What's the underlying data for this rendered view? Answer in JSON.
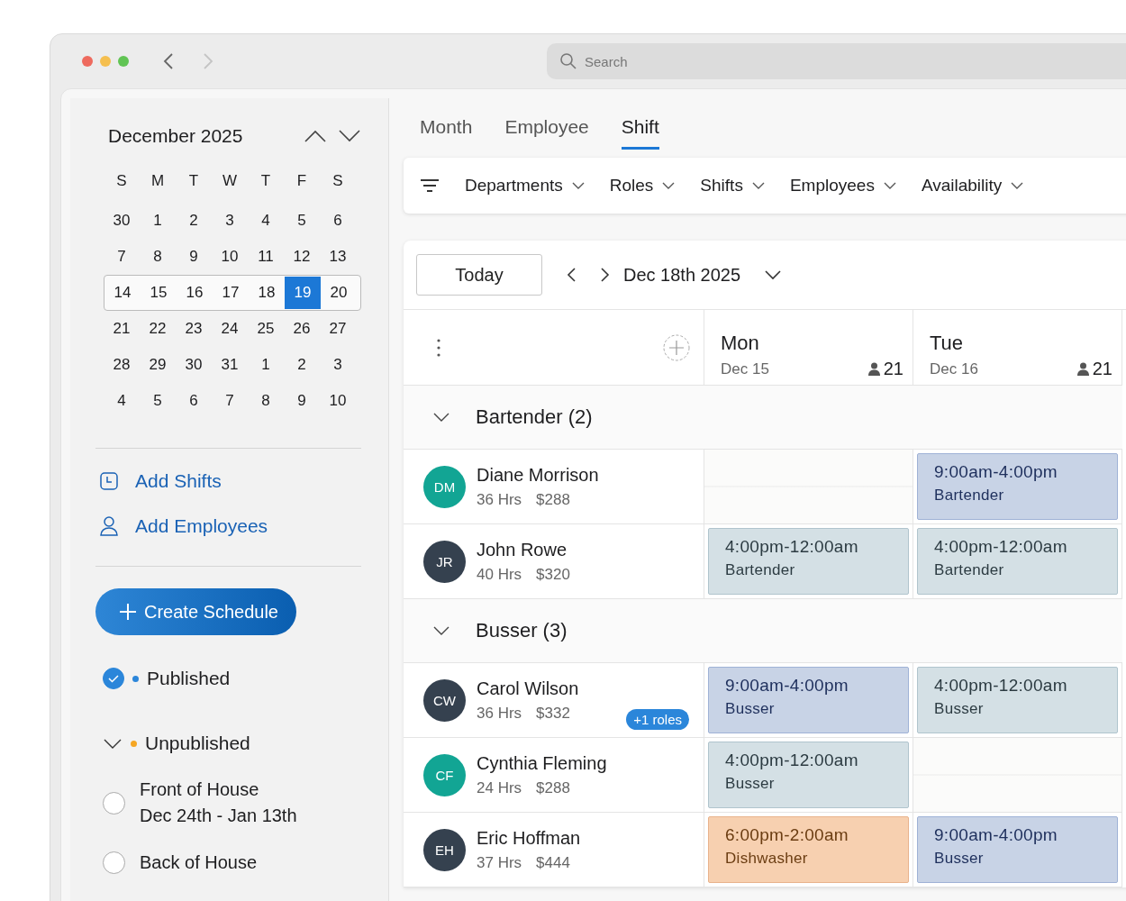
{
  "toolbar": {
    "search": {
      "placeholder": "Search"
    }
  },
  "calendar": {
    "title": "December 2025",
    "weekdays": [
      "S",
      "M",
      "T",
      "W",
      "T",
      "F",
      "S"
    ],
    "weeks": [
      {
        "selected": false,
        "days": [
          {
            "label": "30",
            "selected": false
          },
          {
            "label": "1",
            "selected": false
          },
          {
            "label": "2",
            "selected": false
          },
          {
            "label": "3",
            "selected": false
          },
          {
            "label": "4",
            "selected": false
          },
          {
            "label": "5",
            "selected": false
          },
          {
            "label": "6",
            "selected": false
          }
        ]
      },
      {
        "selected": false,
        "days": [
          {
            "label": "7",
            "selected": false
          },
          {
            "label": "8",
            "selected": false
          },
          {
            "label": "9",
            "selected": false
          },
          {
            "label": "10",
            "selected": false
          },
          {
            "label": "11",
            "selected": false
          },
          {
            "label": "12",
            "selected": false
          },
          {
            "label": "13",
            "selected": false
          }
        ]
      },
      {
        "selected": true,
        "days": [
          {
            "label": "14",
            "selected": false
          },
          {
            "label": "15",
            "selected": false
          },
          {
            "label": "16",
            "selected": false
          },
          {
            "label": "17",
            "selected": false
          },
          {
            "label": "18",
            "selected": false
          },
          {
            "label": "19",
            "selected": true
          },
          {
            "label": "20",
            "selected": false
          }
        ]
      },
      {
        "selected": false,
        "days": [
          {
            "label": "21",
            "selected": false
          },
          {
            "label": "22",
            "selected": false
          },
          {
            "label": "23",
            "selected": false
          },
          {
            "label": "24",
            "selected": false
          },
          {
            "label": "25",
            "selected": false
          },
          {
            "label": "26",
            "selected": false
          },
          {
            "label": "27",
            "selected": false
          }
        ]
      },
      {
        "selected": false,
        "days": [
          {
            "label": "28",
            "selected": false
          },
          {
            "label": "29",
            "selected": false
          },
          {
            "label": "30",
            "selected": false
          },
          {
            "label": "31",
            "selected": false
          },
          {
            "label": "1",
            "selected": false
          },
          {
            "label": "2",
            "selected": false
          },
          {
            "label": "3",
            "selected": false
          }
        ]
      },
      {
        "selected": false,
        "days": [
          {
            "label": "4",
            "selected": false
          },
          {
            "label": "5",
            "selected": false
          },
          {
            "label": "6",
            "selected": false
          },
          {
            "label": "7",
            "selected": false
          },
          {
            "label": "8",
            "selected": false
          },
          {
            "label": "9",
            "selected": false
          },
          {
            "label": "10",
            "selected": false
          }
        ]
      }
    ]
  },
  "actions": [
    {
      "kind": "shifts",
      "label": "Add Shifts"
    },
    {
      "kind": "employees",
      "label": "Add Employees"
    }
  ],
  "create_button": "Create Schedule",
  "schedules": [
    {
      "kind": "status",
      "label": "Published",
      "checked": true,
      "color": "#2b86da"
    },
    {
      "kind": "group",
      "label": "Unpublished",
      "expanded": true,
      "color": "#f5a623"
    },
    {
      "kind": "item",
      "label": "Front of House",
      "dates": "Dec 24th - Jan 13th",
      "checked": false
    },
    {
      "kind": "item",
      "label": "Back of House",
      "checked": false
    }
  ],
  "tabs": [
    {
      "label": "Month",
      "selected": false
    },
    {
      "label": "Employee",
      "selected": false
    },
    {
      "label": "Shift",
      "selected": true
    }
  ],
  "filters": [
    "Departments",
    "Roles",
    "Shifts",
    "Employees",
    "Availability"
  ],
  "nav": {
    "today": "Today",
    "date": "Dec 18th 2025"
  },
  "days": [
    {
      "day": "Mon",
      "date": "Dec 15",
      "count": "21"
    },
    {
      "day": "Tue",
      "date": "Dec 16",
      "count": "21"
    }
  ],
  "groups": [
    {
      "title": "Bartender (2)",
      "expanded": true,
      "employees": [
        {
          "initials": "DM",
          "name": "Diane Morrison",
          "hours": "36 Hrs",
          "pay": "$288",
          "color": "#12a594",
          "shifts": [
            {
              "kind": "empty"
            },
            {
              "kind": "day",
              "time": "9:00am-4:00pm",
              "role": "Bartender"
            }
          ]
        },
        {
          "initials": "JR",
          "name": "John Rowe",
          "hours": "40 Hrs",
          "pay": "$320",
          "color": "#35414f",
          "shifts": [
            {
              "kind": "evening",
              "time": "4:00pm-12:00am",
              "role": "Bartender"
            },
            {
              "kind": "evening",
              "time": "4:00pm-12:00am",
              "role": "Bartender"
            }
          ]
        }
      ]
    },
    {
      "title": "Busser (3)",
      "expanded": true,
      "employees": [
        {
          "initials": "CW",
          "name": "Carol Wilson",
          "hours": "36 Hrs",
          "pay": "$332",
          "badge": "+1 roles",
          "color": "#35414f",
          "shifts": [
            {
              "kind": "day",
              "time": "9:00am-4:00pm",
              "role": "Busser"
            },
            {
              "kind": "evening",
              "time": "4:00pm-12:00am",
              "role": "Busser"
            }
          ]
        },
        {
          "initials": "CF",
          "name": "Cynthia Fleming",
          "hours": "24 Hrs",
          "pay": "$288",
          "color": "#12a594",
          "shifts": [
            {
              "kind": "evening",
              "time": "4:00pm-12:00am",
              "role": "Busser"
            },
            {
              "kind": "empty"
            }
          ]
        },
        {
          "initials": "EH",
          "name": "Eric Hoffman",
          "hours": "37 Hrs",
          "pay": "$444",
          "color": "#35414f",
          "shifts": [
            {
              "kind": "other",
              "time": "6:00pm-2:00am",
              "role": "Dishwasher"
            },
            {
              "kind": "day",
              "time": "9:00am-4:00pm",
              "role": "Busser"
            }
          ]
        }
      ]
    }
  ]
}
